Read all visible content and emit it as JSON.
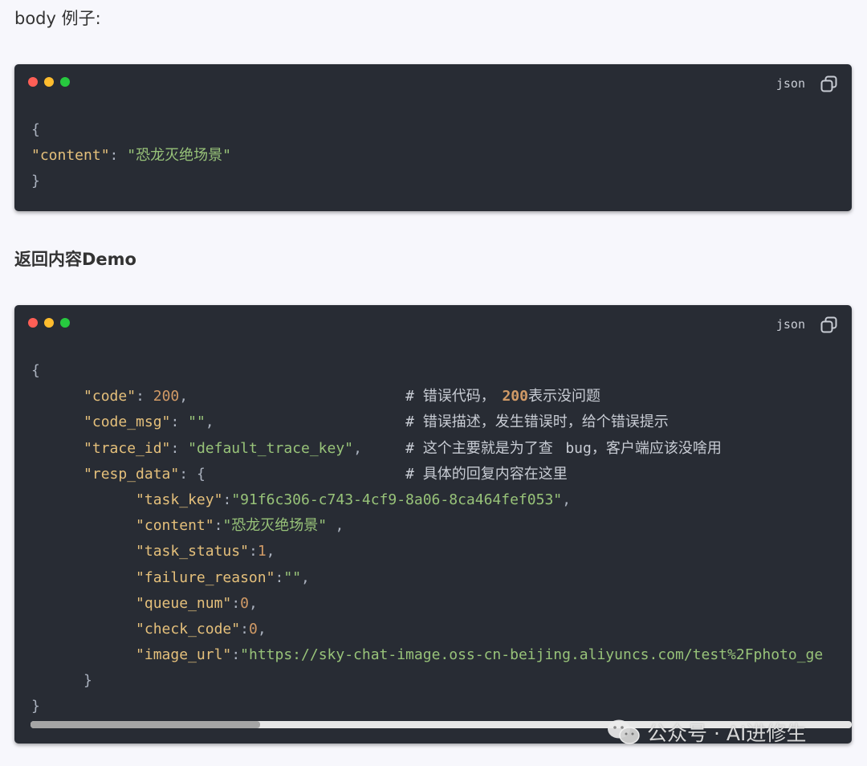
{
  "texts": {
    "body_example": "body 例子:",
    "demo_heading": "返回内容Demo"
  },
  "colors": {
    "page_bg": "#f7f7fc",
    "code_bg": "#282c34",
    "key": "#e5c07b",
    "string": "#98c379",
    "number": "#d19a66",
    "dot_red": "#ff5f56",
    "dot_yellow": "#ffbd2e",
    "dot_green": "#27c93f"
  },
  "blocks": [
    {
      "lang": "json",
      "copy_icon": "copy-icon",
      "lines": [
        [
          {
            "t": "{",
            "c": "p"
          }
        ],
        [
          {
            "t": "\"content\"",
            "c": "k"
          },
          {
            "t": ": ",
            "c": "p"
          },
          {
            "t": "\"恐龙灭绝场景\"",
            "c": "s"
          }
        ],
        [
          {
            "t": "}",
            "c": "p"
          }
        ]
      ]
    },
    {
      "lang": "json",
      "copy_icon": "copy-icon",
      "lines": [
        [
          {
            "t": "{",
            "c": "p"
          }
        ],
        [
          {
            "t": "      \"code\"",
            "c": "k"
          },
          {
            "t": ": ",
            "c": "p"
          },
          {
            "t": "200",
            "c": "n"
          },
          {
            "t": ",",
            "c": "p"
          },
          {
            "t": "# 错误代码，",
            "c": "c",
            "col": 43
          },
          {
            "t": "200",
            "c": "cn"
          },
          {
            "t": "表示没问题",
            "c": "c"
          }
        ],
        [
          {
            "t": "      \"code_msg\"",
            "c": "k"
          },
          {
            "t": ": ",
            "c": "p"
          },
          {
            "t": "\"\"",
            "c": "s"
          },
          {
            "t": ",",
            "c": "p"
          },
          {
            "t": "# 错误描述，发生错误时，给个错误提示",
            "c": "c",
            "col": 43
          }
        ],
        [
          {
            "t": "      \"trace_id\"",
            "c": "k"
          },
          {
            "t": ": ",
            "c": "p"
          },
          {
            "t": "\"default_trace_key\"",
            "c": "s"
          },
          {
            "t": ",",
            "c": "p"
          },
          {
            "t": "# 这个主要就是为了查",
            "c": "c",
            "col": 43
          },
          {
            "t": "bug",
            "c": "c"
          },
          {
            "t": "，客户端应该没啥用",
            "c": "c"
          }
        ],
        [
          {
            "t": "      \"resp_data\"",
            "c": "k"
          },
          {
            "t": ": {",
            "c": "p"
          },
          {
            "t": "# 具体的回复内容在这里",
            "c": "c",
            "col": 43
          }
        ],
        [
          {
            "t": "            \"task_key\"",
            "c": "k"
          },
          {
            "t": ":",
            "c": "p"
          },
          {
            "t": "\"91f6c306-c743-4cf9-8a06-8ca464fef053\"",
            "c": "s"
          },
          {
            "t": ",",
            "c": "p"
          }
        ],
        [
          {
            "t": "            \"content\"",
            "c": "k"
          },
          {
            "t": ":",
            "c": "p"
          },
          {
            "t": "\"恐龙灭绝场景\"",
            "c": "s"
          },
          {
            "t": ",",
            "c": "p"
          }
        ],
        [
          {
            "t": "            \"task_status\"",
            "c": "k"
          },
          {
            "t": ":",
            "c": "p"
          },
          {
            "t": "1",
            "c": "n"
          },
          {
            "t": ",",
            "c": "p"
          }
        ],
        [
          {
            "t": "            \"failure_reason\"",
            "c": "k"
          },
          {
            "t": ":",
            "c": "p"
          },
          {
            "t": "\"\"",
            "c": "s"
          },
          {
            "t": ",",
            "c": "p"
          }
        ],
        [
          {
            "t": "            \"queue_num\"",
            "c": "k"
          },
          {
            "t": ":",
            "c": "p"
          },
          {
            "t": "0",
            "c": "n"
          },
          {
            "t": ",",
            "c": "p"
          }
        ],
        [
          {
            "t": "            \"check_code\"",
            "c": "k"
          },
          {
            "t": ":",
            "c": "p"
          },
          {
            "t": "0",
            "c": "n"
          },
          {
            "t": ",",
            "c": "p"
          }
        ],
        [
          {
            "t": "            \"image_url\"",
            "c": "k"
          },
          {
            "t": ":",
            "c": "p"
          },
          {
            "t": "\"https://sky-chat-image.oss-cn-beijing.aliyuncs.com/test%2Fphoto_ge",
            "c": "s"
          }
        ],
        [
          {
            "t": "      }",
            "c": "p"
          }
        ],
        [
          {
            "t": "}",
            "c": "p"
          }
        ]
      ],
      "scroll_fraction_visible": 0.28
    }
  ],
  "watermark": {
    "icon": "wechat-icon",
    "text": "公众号 · AI进修生"
  }
}
